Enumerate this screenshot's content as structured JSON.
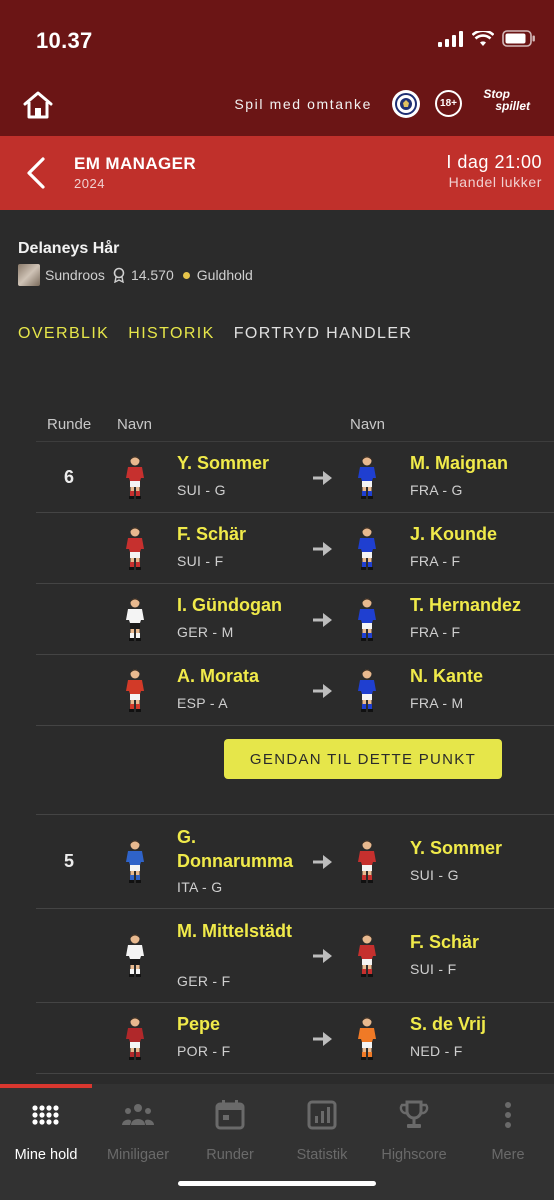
{
  "status_bar": {
    "time": "10.37"
  },
  "top_bar": {
    "responsible_text": "Spil med omtanke",
    "age_badge": "18+",
    "stop_line1": "Stop",
    "stop_line2": "spillet"
  },
  "header": {
    "title": "EM MANAGER",
    "year": "2024",
    "deadline_time": "I dag 21:00",
    "deadline_label": "Handel lukker"
  },
  "team": {
    "name": "Delaneys Hår",
    "owner": "Sundroos",
    "points": "14.570",
    "tier": "Guldhold"
  },
  "tabs": [
    "OVERBLIK",
    "HISTORIK",
    "FORTRYD HANDLER"
  ],
  "table": {
    "col_round": "Runde",
    "col_name_out": "Navn",
    "col_name_in": "Navn",
    "groups": [
      {
        "round": "6",
        "trades": [
          {
            "out": {
              "name": "Y. Sommer",
              "info": "SUI - G",
              "kit": "#c6302e"
            },
            "in": {
              "name": "M. Maignan",
              "info": "FRA - G",
              "kit": "#1f3fd0"
            }
          },
          {
            "out": {
              "name": "F. Schär",
              "info": "SUI - F",
              "kit": "#c6302e"
            },
            "in": {
              "name": "J. Kounde",
              "info": "FRA - F",
              "kit": "#1f3fd0"
            }
          },
          {
            "out": {
              "name": "I. Gündogan",
              "info": "GER - M",
              "kit": "#f4f4f4"
            },
            "in": {
              "name": "T. Hernandez",
              "info": "FRA - F",
              "kit": "#1f3fd0"
            }
          },
          {
            "out": {
              "name": "A. Morata",
              "info": "ESP - A",
              "kit": "#d23a28"
            },
            "in": {
              "name": "N. Kante",
              "info": "FRA - M",
              "kit": "#1f3fd0"
            }
          }
        ],
        "restore_label": "GENDAN TIL DETTE PUNKT"
      },
      {
        "round": "5",
        "trades": [
          {
            "out": {
              "name": "G. Donnarumma",
              "info": "ITA - G",
              "kit": "#2f63c9"
            },
            "in": {
              "name": "Y. Sommer",
              "info": "SUI - G",
              "kit": "#c6302e"
            }
          },
          {
            "out": {
              "name": "M. Mittelstädt",
              "info": "GER - F",
              "kit": "#f4f4f4"
            },
            "in": {
              "name": "F. Schär",
              "info": "SUI - F",
              "kit": "#c6302e"
            }
          },
          {
            "out": {
              "name": "Pepe",
              "info": "POR - F",
              "kit": "#b0282a"
            },
            "in": {
              "name": "S. de Vrij",
              "info": "NED - F",
              "kit": "#f07a26"
            }
          }
        ]
      }
    ]
  },
  "bottom_nav": [
    "Mine hold",
    "Miniligaer",
    "Runder",
    "Statistik",
    "Highscore",
    "Mere"
  ],
  "colors": {
    "accent_yellow": "#e6e64a",
    "header_red": "#c0302b",
    "top_maroon": "#6b1515"
  }
}
